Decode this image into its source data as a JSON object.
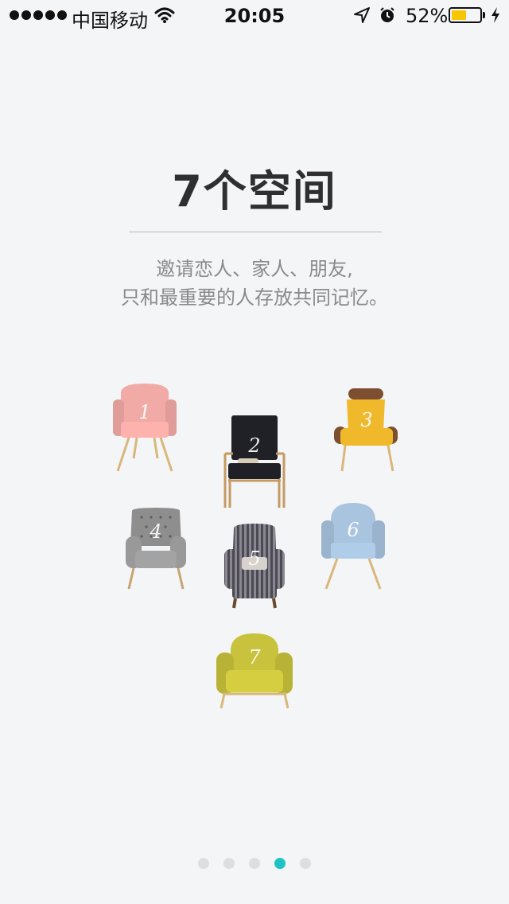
{
  "status_bar": {
    "carrier": "中国移动",
    "time": "20:05",
    "battery_percent": "52%",
    "battery_level": 0.52,
    "battery_color": "#f7c600"
  },
  "intro": {
    "title": "7个空间",
    "subtitle_line1": "邀请恋人、家人、朋友,",
    "subtitle_line2": "只和最重要的人存放共同记忆。"
  },
  "chairs": [
    {
      "label": "1",
      "color": "#f2aaa6"
    },
    {
      "label": "2",
      "color": "#1f2126"
    },
    {
      "label": "3",
      "color": "#f0b92c"
    },
    {
      "label": "4",
      "color": "#8e8e8e"
    },
    {
      "label": "5",
      "color": "#7b7b84"
    },
    {
      "label": "6",
      "color": "#a8c4df"
    },
    {
      "label": "7",
      "color": "#c8c23c"
    }
  ],
  "pager": {
    "page_count": 5,
    "current_page": 4,
    "active_color": "#1ec3c2"
  }
}
